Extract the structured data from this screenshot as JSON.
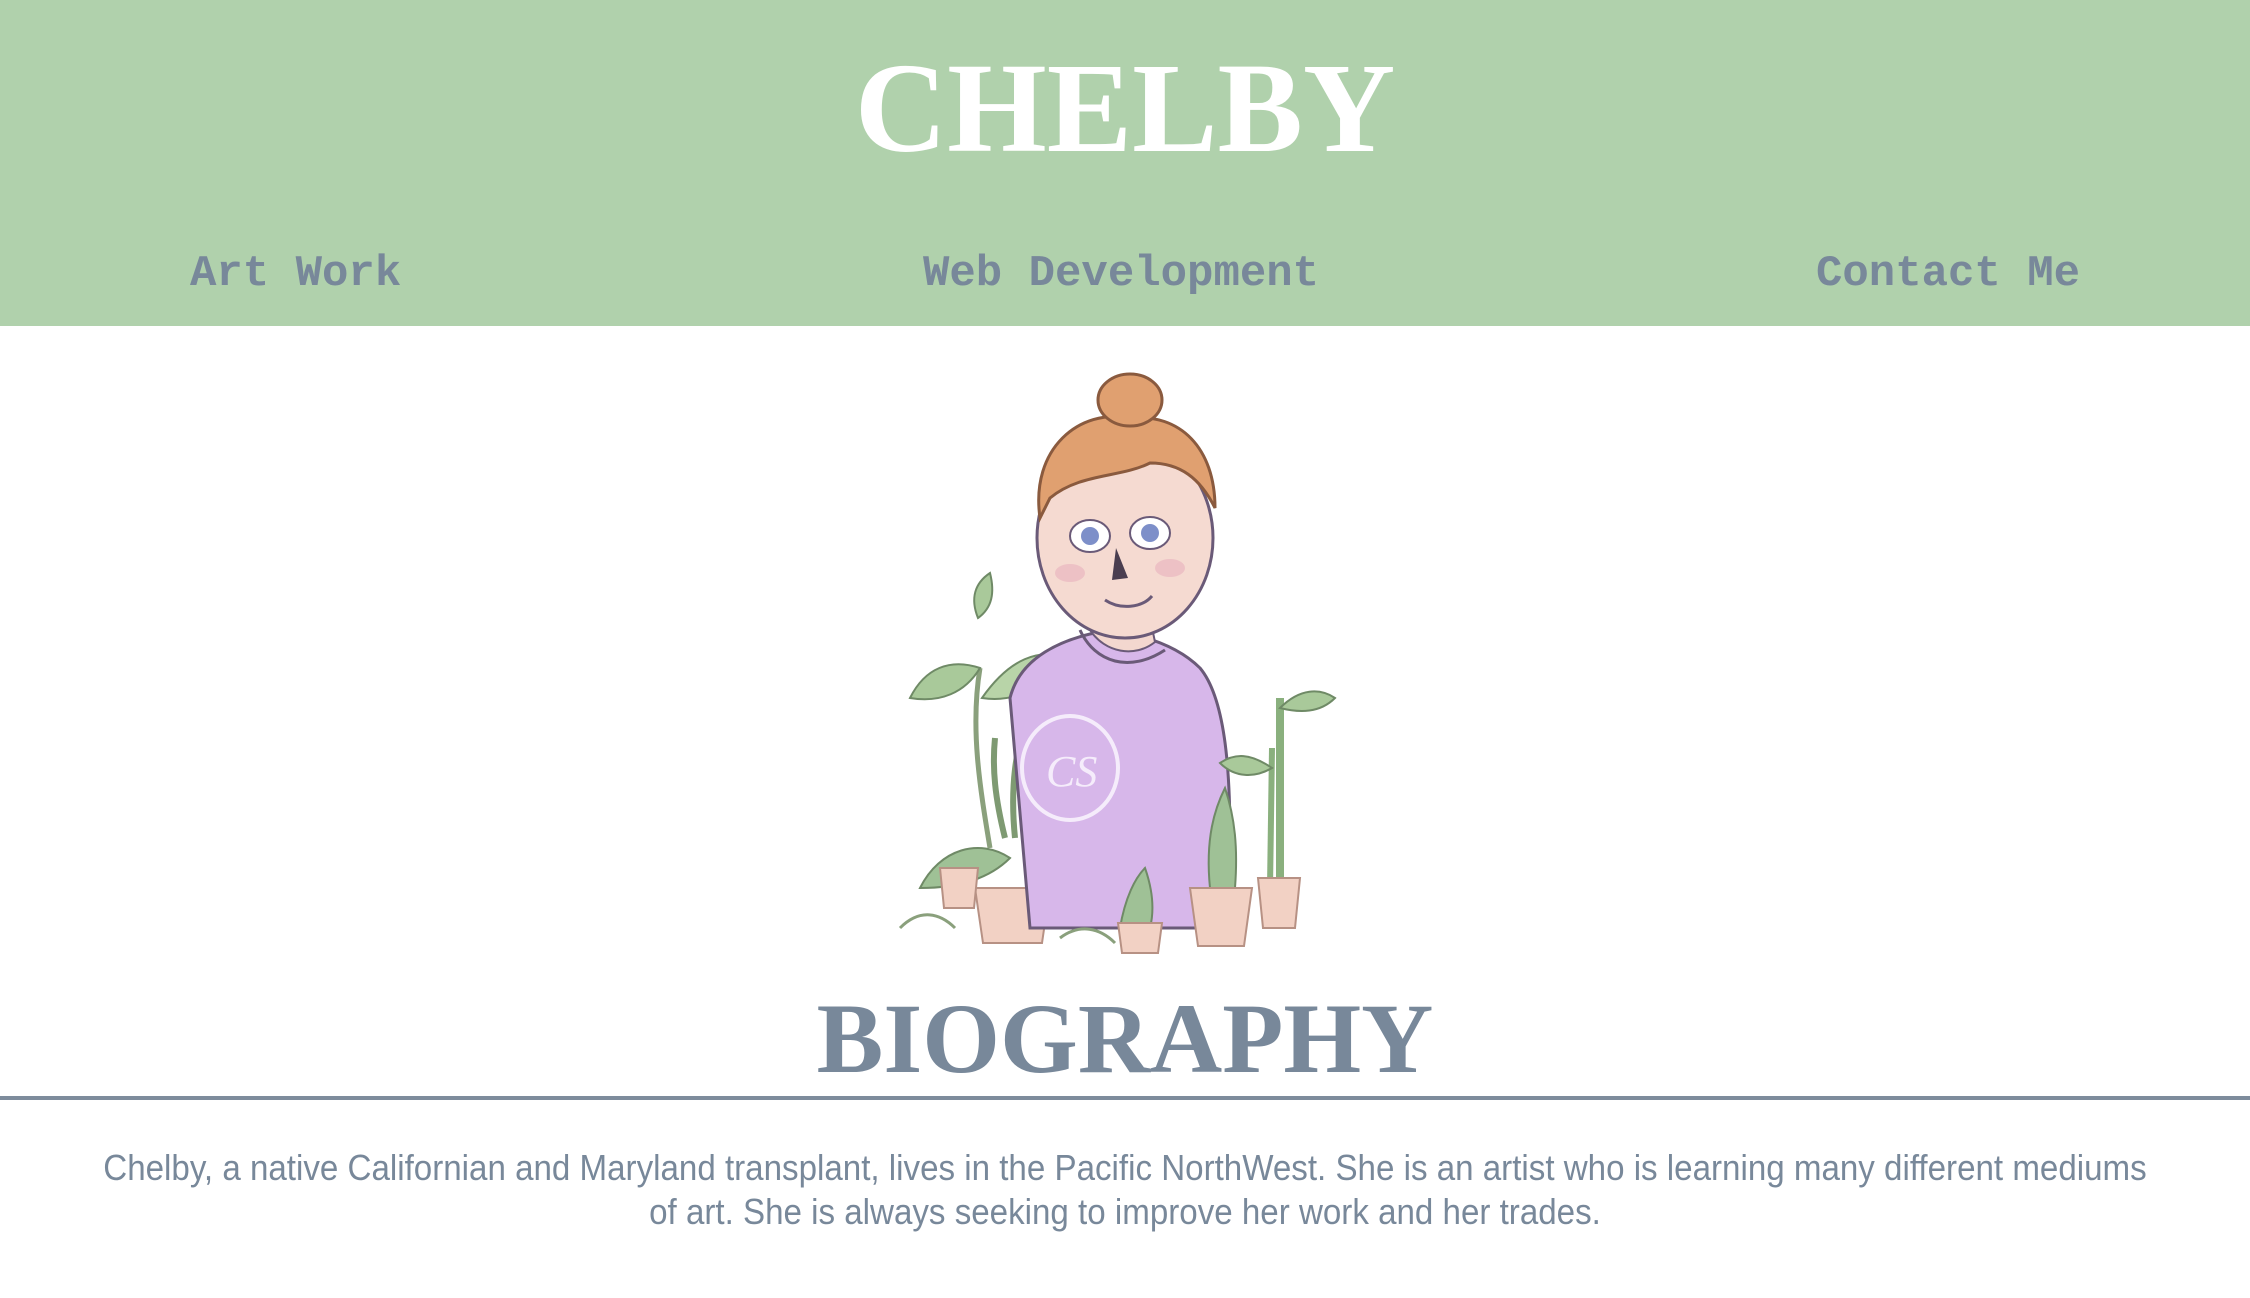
{
  "header": {
    "title": "CHELBY",
    "background_color": "#b0d1ac",
    "title_color": "#ffffff"
  },
  "nav": {
    "items": [
      {
        "label": "Art Work"
      },
      {
        "label": "Web Development"
      },
      {
        "label": "Contact Me"
      }
    ],
    "color": "#78889a"
  },
  "portrait": {
    "icon": "illustrated-self-portrait-with-plants"
  },
  "biography": {
    "heading": "BIOGRAPHY",
    "text": "Chelby, a native Californian and Maryland transplant, lives in the Pacific NorthWest. She is an artist who is learning many different mediums of art. She is always seeking to improve her work and her trades."
  }
}
